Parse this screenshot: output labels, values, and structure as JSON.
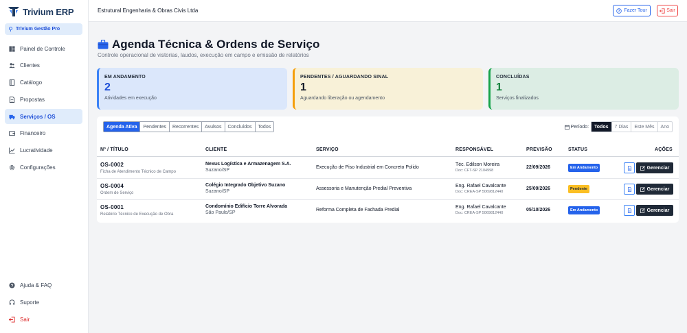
{
  "app": {
    "brand": "Trivium ERP",
    "plan": "Trivium Gestão Pro"
  },
  "sidebar": {
    "items": [
      {
        "label": "Painel de Controle",
        "icon": "dashboard-icon"
      },
      {
        "label": "Clientes",
        "icon": "users-icon"
      },
      {
        "label": "Catálogo",
        "icon": "book-icon"
      },
      {
        "label": "Propostas",
        "icon": "document-icon"
      },
      {
        "label": "Serviços / OS",
        "icon": "truck-icon",
        "active": true
      },
      {
        "label": "Financeiro",
        "icon": "wallet-icon"
      },
      {
        "label": "Lucratividade",
        "icon": "chart-line-icon"
      },
      {
        "label": "Configurações",
        "icon": "gear-icon"
      }
    ],
    "bottom": [
      {
        "label": "Ajuda & FAQ",
        "icon": "help-icon"
      },
      {
        "label": "Suporte",
        "icon": "headset-icon"
      },
      {
        "label": "Sair",
        "icon": "logout-icon"
      }
    ]
  },
  "topbar": {
    "company": "Estrutural Engenharia & Obras Civis Ltda",
    "tour_label": "Fazer Tour",
    "logout_label": "Sair"
  },
  "header": {
    "title": "Agenda Técnica & Ordens de Serviço",
    "subtitle": "Controle operacional de vistorias, laudos, execução em campo e emissão de relatórios"
  },
  "cards": [
    {
      "label": "EM ANDAMENTO",
      "count": "2",
      "desc": "Atividades em execução"
    },
    {
      "label": "PENDENTES / AGUARDANDO SINAL",
      "count": "1",
      "desc": "Aguardando liberação ou agendamento"
    },
    {
      "label": "CONCLUÍDAS",
      "count": "1",
      "desc": "Serviços finalizados"
    }
  ],
  "tabs": [
    "Agenda Ativa",
    "Pendentes",
    "Recorrentes",
    "Avulsos",
    "Concluídos",
    "Todos"
  ],
  "active_tab": "Agenda Ativa",
  "period": {
    "label": "Período:",
    "options": [
      "Todos",
      "7 Dias",
      "Este Mês",
      "Ano"
    ],
    "selected": "Todos"
  },
  "table": {
    "headers": [
      "Nº / TÍTULO",
      "CLIENTE",
      "SERVIÇO",
      "RESPONSÁVEL",
      "PREVISÃO",
      "STATUS",
      "AÇÕES"
    ],
    "manage_label": "Gerenciar",
    "rows": [
      {
        "num": "OS-0002",
        "title": "Ficha de Atendimento Técnico de Campo",
        "client": "Nexus Logística e Armazenagem S.A.",
        "city": "Suzano/SP",
        "service": "Execução de Piso Industrial em Concreto Polido",
        "resp": "Téc. Edilson Moreira",
        "doc": "Doc: CFT-SP 2104998",
        "date": "22/09/2026",
        "status": "Em Andamento",
        "status_kind": "progress"
      },
      {
        "num": "OS-0004",
        "title": "Ordem de Serviço",
        "client": "Colégio Integrado Objetivo Suzano",
        "city": "Suzano/SP",
        "service": "Assessoria e Manutenção Predial Preventiva",
        "resp": "Eng. Rafael Cavalcante",
        "doc": "Doc: CREA-SP 5069812440",
        "date": "25/09/2026",
        "status": "Pendente",
        "status_kind": "pending"
      },
      {
        "num": "OS-0001",
        "title": "Relatório Técnico de Execução de Obra",
        "client": "Condomínio Edifício Torre Alvorada",
        "city": "São Paulo/SP",
        "service": "Reforma Completa de Fachada Predial",
        "resp": "Eng. Rafael Cavalcante",
        "doc": "Doc: CREA-SP 5069812440",
        "date": "05/10/2026",
        "status": "Em Andamento",
        "status_kind": "progress"
      }
    ]
  },
  "colors": {
    "primary": "#2563eb",
    "dark": "#1f2937",
    "pending": "#fbbf24",
    "danger": "#ef4444"
  }
}
